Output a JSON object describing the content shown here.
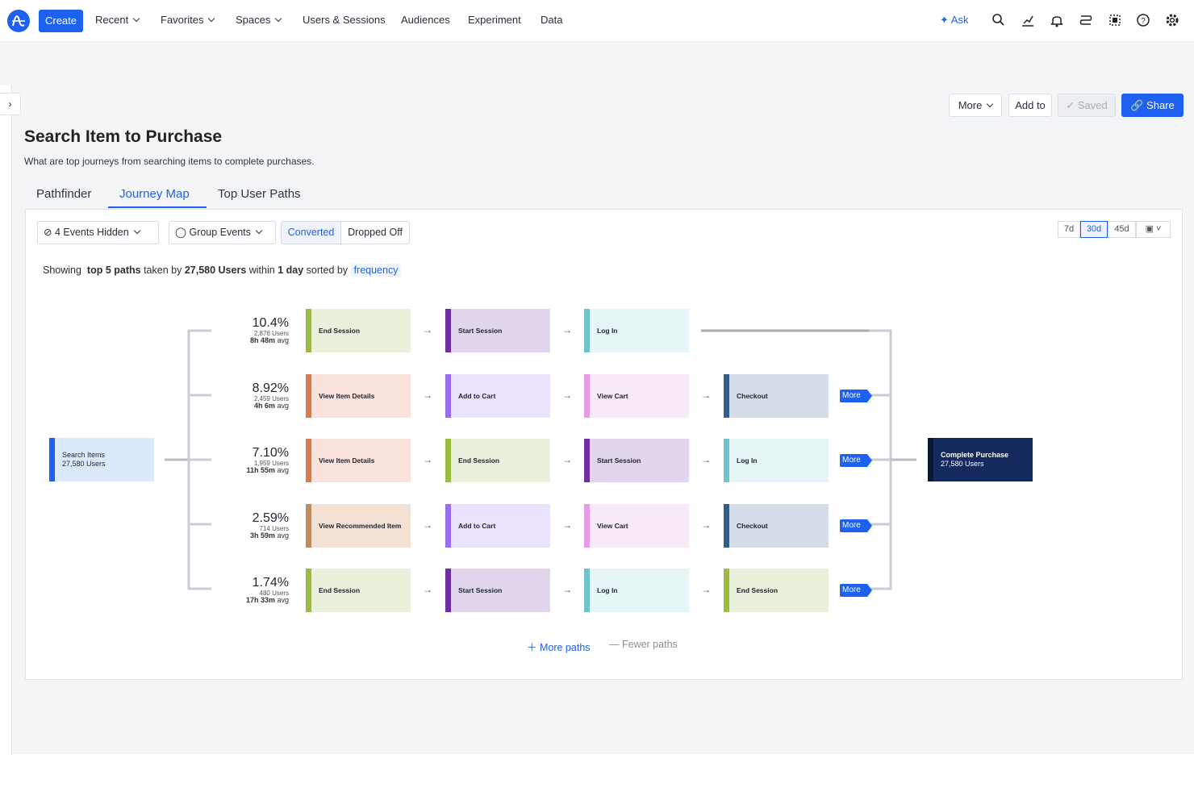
{
  "nav": {
    "create": "Create",
    "recent": "Recent",
    "favorites": "Favorites",
    "spaces": "Spaces",
    "users_sessions": "Users & Sessions",
    "audiences": "Audiences",
    "experiment": "Experiment",
    "data": "Data",
    "ask": "Ask"
  },
  "toolbar": {
    "more": "More",
    "add_to": "Add to",
    "saved": "Saved",
    "share": "Share"
  },
  "page": {
    "title": "Search Item to Purchase",
    "description": "What are top journeys from searching items to complete purchases."
  },
  "tabs": [
    "Pathfinder",
    "Journey Map",
    "Top User Paths"
  ],
  "filters": {
    "events_hidden": "4 Events Hidden",
    "group_events": "Group Events",
    "converted": "Converted",
    "dropped_off": "Dropped Off",
    "ranges": [
      "7d",
      "30d",
      "45d"
    ]
  },
  "summary": {
    "showing": "Showing",
    "top_paths": "top 5 paths",
    "taken_by": "taken by",
    "users": "27,580 Users",
    "within": "within",
    "window": "1 day",
    "sorted_by": "sorted by",
    "sort": "frequency"
  },
  "start": {
    "label": "Search Items",
    "users": "27,580 Users"
  },
  "end": {
    "label": "Complete Purchase",
    "users": "27,580 Users"
  },
  "paths": [
    {
      "pct": "10.4%",
      "users": "2,876 Users",
      "avg": "8h 48m",
      "avg_suffix": "avg",
      "steps": [
        "End Session",
        "Start Session",
        "Log In"
      ],
      "more": false
    },
    {
      "pct": "8.92%",
      "users": "2,459 Users",
      "avg": "4h 6m",
      "avg_suffix": "avg",
      "steps": [
        "View Item Details",
        "Add to Cart",
        "View Cart",
        "Checkout"
      ],
      "more": true
    },
    {
      "pct": "7.10%",
      "users": "1,959 Users",
      "avg": "11h 55m",
      "avg_suffix": "avg",
      "steps": [
        "View Item Details",
        "End Session",
        "Start Session",
        "Log In"
      ],
      "more": true
    },
    {
      "pct": "2.59%",
      "users": "714 Users",
      "avg": "3h 59m",
      "avg_suffix": "avg",
      "steps": [
        "View Recommended Item",
        "Add to Cart",
        "View Cart",
        "Checkout"
      ],
      "more": true
    },
    {
      "pct": "1.74%",
      "users": "480 Users",
      "avg": "17h 33m",
      "avg_suffix": "avg",
      "steps": [
        "End Session",
        "Start Session",
        "Log In",
        "End Session"
      ],
      "more": true
    }
  ],
  "more_label": "More",
  "more_paths": "More paths",
  "fewer_paths": "Fewer paths",
  "colors": {
    "accent": "#1e61f0",
    "end_session": "#9bbd3f",
    "start_session": "#6f2ea3",
    "log_in": "#6fc4cc",
    "view_item": "#e0784e",
    "add_to_cart": "#9a6cf0",
    "view_cart": "#e59be6",
    "checkout": "#2d5f8f",
    "view_recommended": "#c48a5a"
  }
}
